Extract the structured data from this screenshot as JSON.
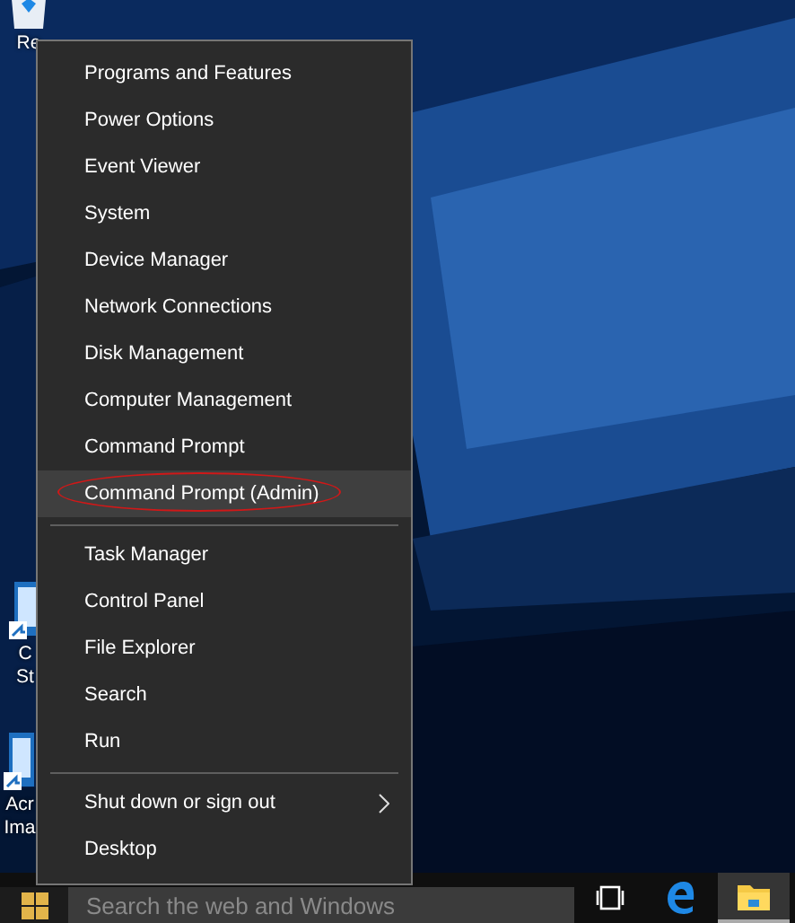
{
  "desktop_icons": [
    {
      "kind": "recycle",
      "label_lines": [
        "Re"
      ]
    },
    {
      "kind": "shortcut",
      "label_lines": [
        "C",
        "St"
      ]
    },
    {
      "kind": "shortcut",
      "label_lines": [
        "Acr",
        "Ima"
      ]
    }
  ],
  "menu": {
    "groups": [
      [
        {
          "label": "Programs and Features",
          "selected": false,
          "submenu": false,
          "circled": false
        },
        {
          "label": "Power Options",
          "selected": false,
          "submenu": false,
          "circled": false
        },
        {
          "label": "Event Viewer",
          "selected": false,
          "submenu": false,
          "circled": false
        },
        {
          "label": "System",
          "selected": false,
          "submenu": false,
          "circled": false
        },
        {
          "label": "Device Manager",
          "selected": false,
          "submenu": false,
          "circled": false
        },
        {
          "label": "Network Connections",
          "selected": false,
          "submenu": false,
          "circled": false
        },
        {
          "label": "Disk Management",
          "selected": false,
          "submenu": false,
          "circled": false
        },
        {
          "label": "Computer Management",
          "selected": false,
          "submenu": false,
          "circled": false
        },
        {
          "label": "Command Prompt",
          "selected": false,
          "submenu": false,
          "circled": false
        },
        {
          "label": "Command Prompt (Admin)",
          "selected": true,
          "submenu": false,
          "circled": true
        }
      ],
      [
        {
          "label": "Task Manager",
          "selected": false,
          "submenu": false,
          "circled": false
        },
        {
          "label": "Control Panel",
          "selected": false,
          "submenu": false,
          "circled": false
        },
        {
          "label": "File Explorer",
          "selected": false,
          "submenu": false,
          "circled": false
        },
        {
          "label": "Search",
          "selected": false,
          "submenu": false,
          "circled": false
        },
        {
          "label": "Run",
          "selected": false,
          "submenu": false,
          "circled": false
        }
      ],
      [
        {
          "label": "Shut down or sign out",
          "selected": false,
          "submenu": true,
          "circled": false
        },
        {
          "label": "Desktop",
          "selected": false,
          "submenu": false,
          "circled": false
        }
      ]
    ]
  },
  "taskbar": {
    "search": {
      "placeholder": "Search the web and Windows"
    },
    "apps": [
      {
        "kind": "task-view",
        "selected": false
      },
      {
        "kind": "edge",
        "selected": false
      },
      {
        "kind": "explorer",
        "selected": true
      }
    ]
  }
}
